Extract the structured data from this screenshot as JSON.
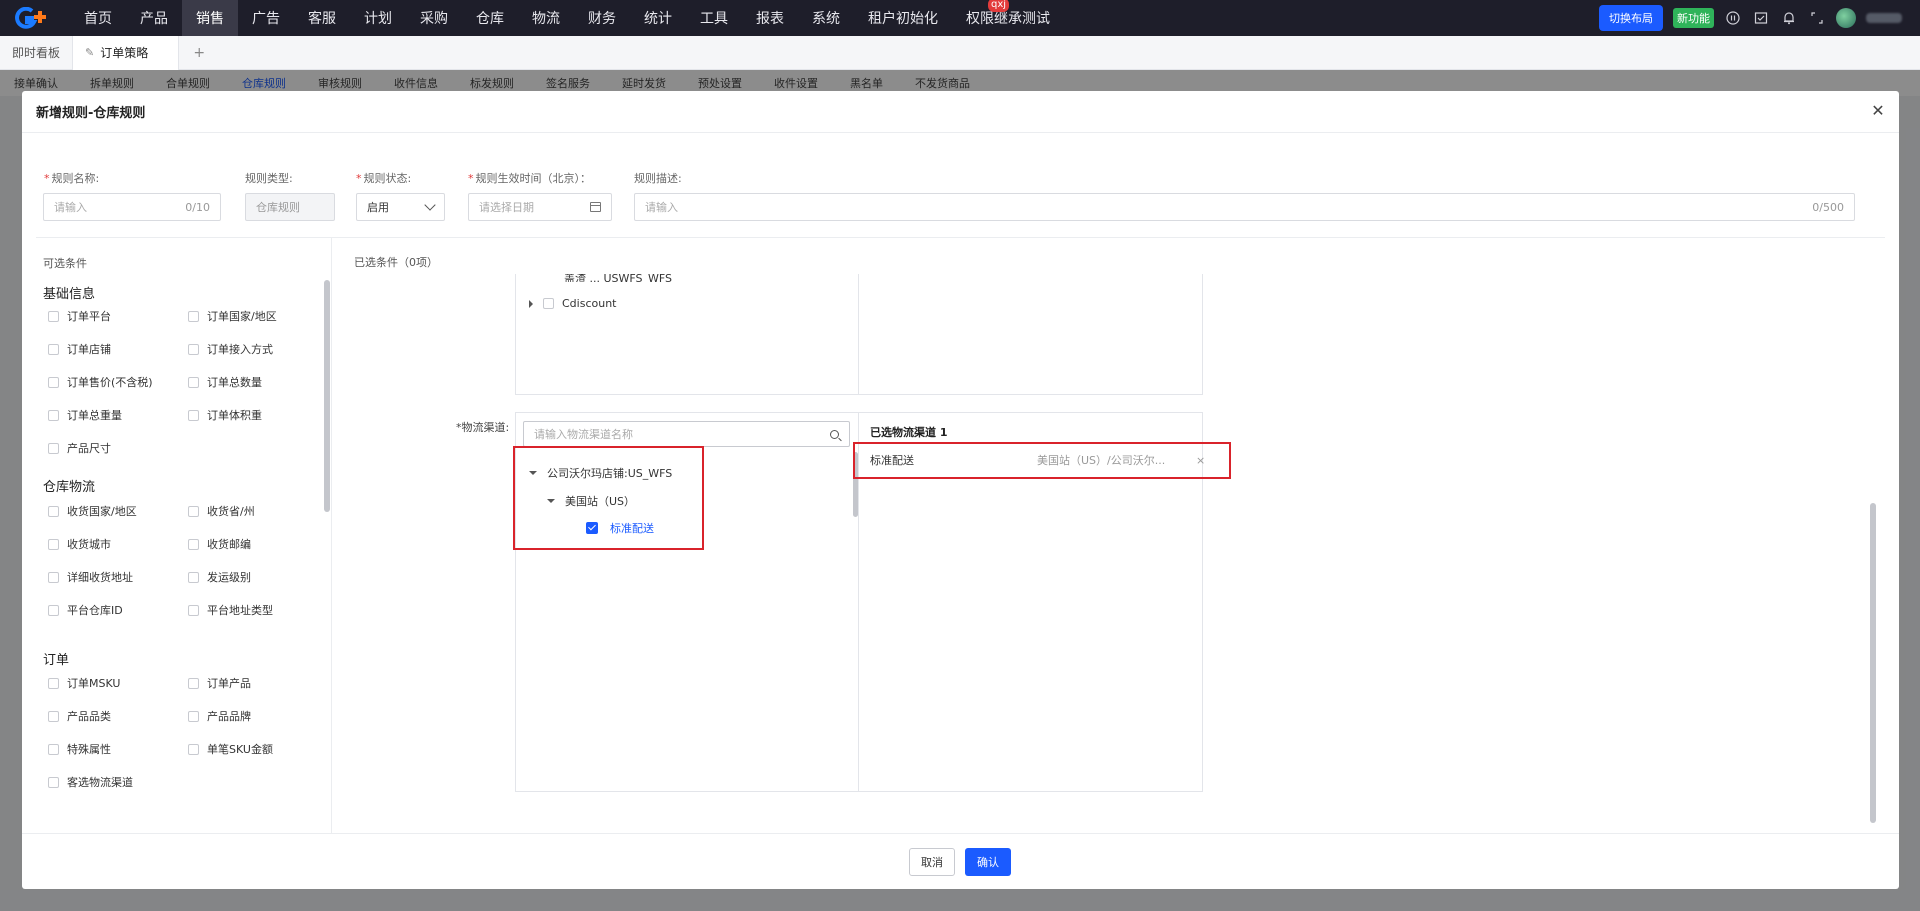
{
  "nav": {
    "items": [
      "首页",
      "产品",
      "销售",
      "广告",
      "客服",
      "计划",
      "采购",
      "仓库",
      "物流",
      "财务",
      "统计",
      "工具",
      "报表",
      "系统",
      "租户初始化",
      "权限继承测试"
    ],
    "active_index": 2,
    "badge": "qxj",
    "switch_layout": "切换布局",
    "new_feature": "新功能"
  },
  "tabs": {
    "dashboard": "即时看板",
    "active": "订单策略",
    "add": "+"
  },
  "bg_subtabs": [
    "接单确认",
    "拆单规则",
    "合单规则",
    "仓库规则",
    "审核规则",
    "收件信息",
    "标发规则",
    "签名服务",
    "延时发货",
    "预处设置",
    "收件设置",
    "黑名单",
    "不发货商品"
  ],
  "modal": {
    "title": "新增规则-仓库规则",
    "fields": {
      "name_label": "规则名称:",
      "name_placeholder": "请输入",
      "name_counter": "0/10",
      "type_label": "规则类型:",
      "type_value": "仓库规则",
      "status_label": "规则状态:",
      "status_value": "启用",
      "effective_label": "规则生效时间（北京）：",
      "effective_placeholder": "请选择日期",
      "desc_label": "规则描述:",
      "desc_placeholder": "请输入",
      "desc_counter": "0/500"
    },
    "left": {
      "title": "可选条件",
      "sections": [
        {
          "title": "基础信息",
          "items": [
            "订单平台",
            "订单国家/地区",
            "订单店铺",
            "订单接入方式",
            "订单售价(不含税)",
            "订单总数量",
            "订单总重量",
            "订单体积重",
            "产品尺寸"
          ]
        },
        {
          "title": "仓库物流",
          "items": [
            "收货国家/地区",
            "收货省/州",
            "收货城市",
            "收货邮编",
            "详细收货地址",
            "发运级别",
            "平台仓库ID",
            "平台地址类型"
          ]
        },
        {
          "title": "订单",
          "items": [
            "订单MSKU",
            "订单产品",
            "产品品类",
            "产品品牌",
            "特殊属性",
            "单笔SKU金额",
            "客选物流渠道"
          ]
        }
      ]
    },
    "right": {
      "selected_conditions": "已选条件（0项）",
      "clipped_row": "盖渣 ... USWFS_WFS",
      "cdiscount": "Cdiscount",
      "logistics_label": "*物流渠道:",
      "search_placeholder": "请输入物流渠道名称",
      "tree": {
        "store": "公司沃尔玛店铺:US_WFS",
        "site": "美国站（US）",
        "channel": "标准配送"
      },
      "selected_title": "已选物流渠道 1",
      "selected_item": {
        "name": "标准配送",
        "route": "美国站（US）/公司沃尔...",
        "remove": "×"
      }
    },
    "footer": {
      "cancel": "取消",
      "confirm": "确认"
    }
  },
  "colors": {
    "nav_bg": "#1e1e2a",
    "primary": "#1b5bff",
    "highlight": "#d9232b",
    "success": "#2fb35a"
  }
}
